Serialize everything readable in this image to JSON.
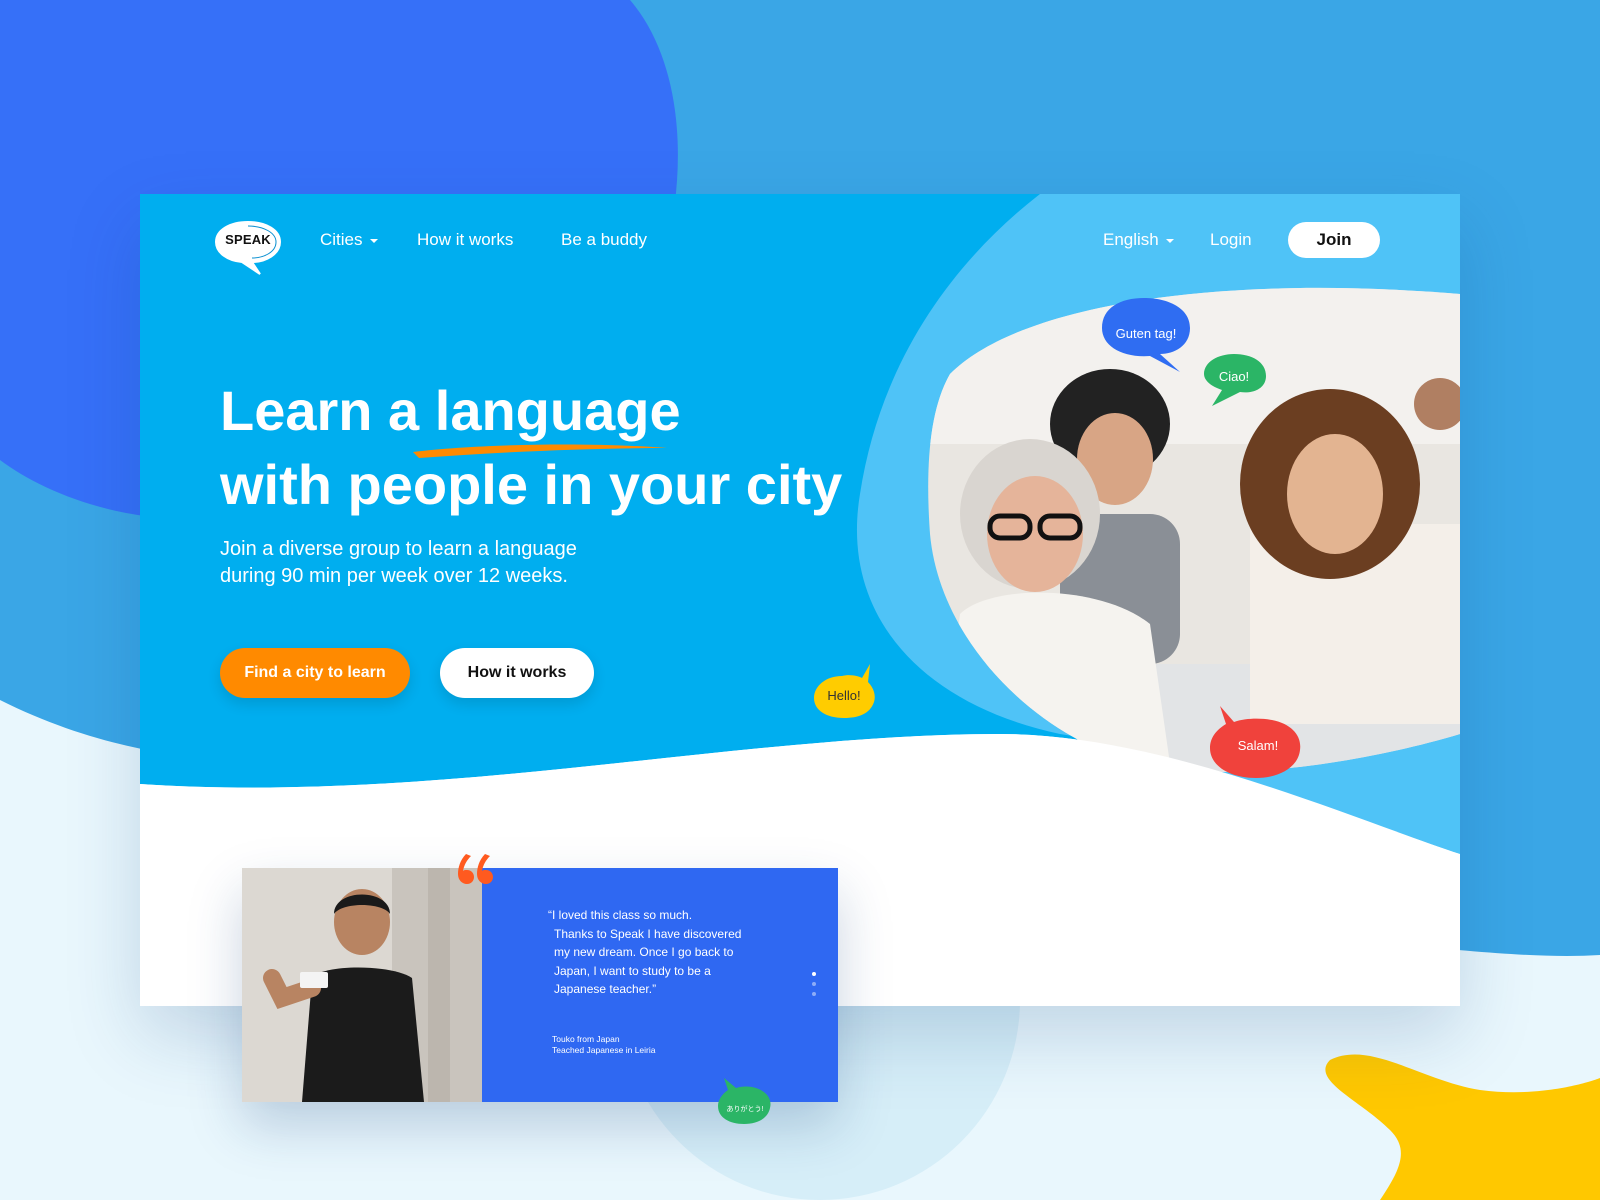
{
  "brand": {
    "logo_text": "SPEAK"
  },
  "nav": {
    "cities_label": "Cities",
    "how_it_works_label": "How it works",
    "be_buddy_label": "Be a buddy",
    "language_label": "English",
    "login_label": "Login",
    "join_label": "Join"
  },
  "hero": {
    "headline_part1": "Learn a ",
    "headline_highlight": "language",
    "headline_line2": "with people in your city",
    "subtitle_line1": "Join a diverse group to learn a language",
    "subtitle_line2": "during 90 min per week over 12 weeks.",
    "cta_primary": "Find a city to learn",
    "cta_secondary": "How it works"
  },
  "bubbles": {
    "guten_tag": "Guten tag!",
    "ciao": "Ciao!",
    "hello": "Hello!",
    "salam": "Salam!",
    "arigatou": "ありがとう!"
  },
  "testimonial": {
    "quote_lines": [
      "“I loved this class so much.",
      "Thanks to Speak I have discovered",
      "my new dream. Once I go back to",
      "Japan, I want to study to be a",
      "Japanese teacher.”"
    ],
    "author_line1": "Touko from Japan",
    "author_line2": "Teached Japanese in Leiria"
  },
  "colors": {
    "hero_blue": "#00aeef",
    "light_blue": "#4fc3f7",
    "orange": "#ff8a00",
    "testimonial_blue": "#2f68f2",
    "bubble_blue": "#2f6df2",
    "bubble_green": "#2bb566",
    "bubble_yellow": "#ffcc00",
    "bubble_red": "#f0423c"
  },
  "icons": {
    "cities_caret": "chevron-down-icon",
    "language_caret": "chevron-down-icon",
    "quote": "quote-icon"
  }
}
